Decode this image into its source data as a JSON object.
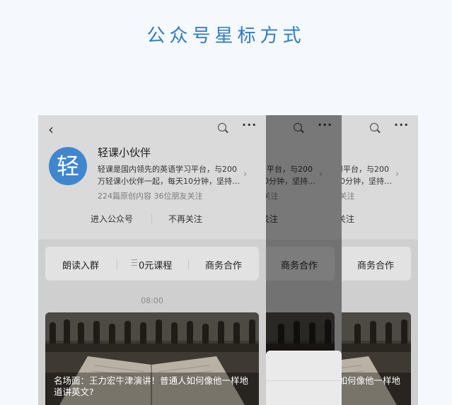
{
  "page": {
    "title": "公众号星标方式"
  },
  "account": {
    "name": "轻课小伙伴",
    "avatar_char": "轻",
    "desc": "轻课是国内领先的英语学习平台，与200\n万轻课小伙伴一起，每天10分钟，坚持…",
    "stats": "224篇原创内容  36位朋友关注",
    "enter_label": "进入公众号",
    "unfollow_label": "不再关注"
  },
  "menu": {
    "items": [
      "朗读入群",
      "0元课程",
      "商务合作"
    ]
  },
  "feed": {
    "timestamp": "08:00",
    "article_title": "名场面：王力宏牛津演讲！普通人如何像他一样地道讲英文?"
  },
  "icons": {
    "back": "back-chevron-icon",
    "search": "search-icon",
    "more": "more-icon",
    "list": "list-icon",
    "chevron": "chevron-right-icon"
  },
  "colors": {
    "title": "#2f7cc4",
    "avatar": "#3f86cf",
    "background": "#f5f8fc"
  }
}
